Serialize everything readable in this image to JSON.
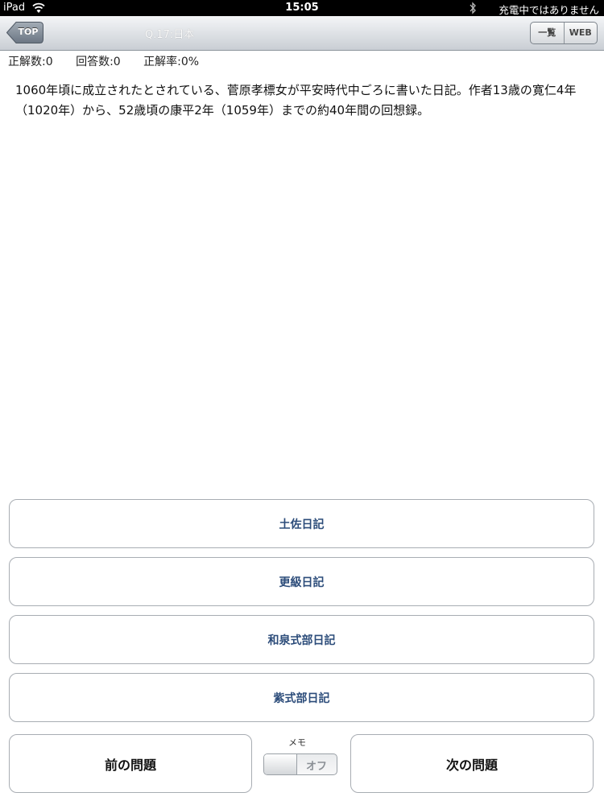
{
  "status_bar": {
    "device": "iPad",
    "time": "15:05",
    "charging_text": "充電中ではありません"
  },
  "nav": {
    "back_label": "TOP",
    "title": "Q.17:日本",
    "segments": [
      "一覧",
      "WEB"
    ]
  },
  "scores": {
    "correct": "正解数:0",
    "answered": "回答数:0",
    "rate": "正解率:0%"
  },
  "question": {
    "text": "1060年頃に成立されたとされている、菅原孝標女が平安時代中ごろに書いた日記。作者13歳の寛仁4年（1020年）から、52歳頃の康平2年（1059年）までの約40年間の回想録。"
  },
  "answers": [
    "土佐日記",
    "更級日記",
    "和泉式部日記",
    "紫式部日記"
  ],
  "footer": {
    "prev_label": "前の問題",
    "next_label": "次の問題",
    "memo_label": "メモ",
    "memo_state": "オフ"
  }
}
